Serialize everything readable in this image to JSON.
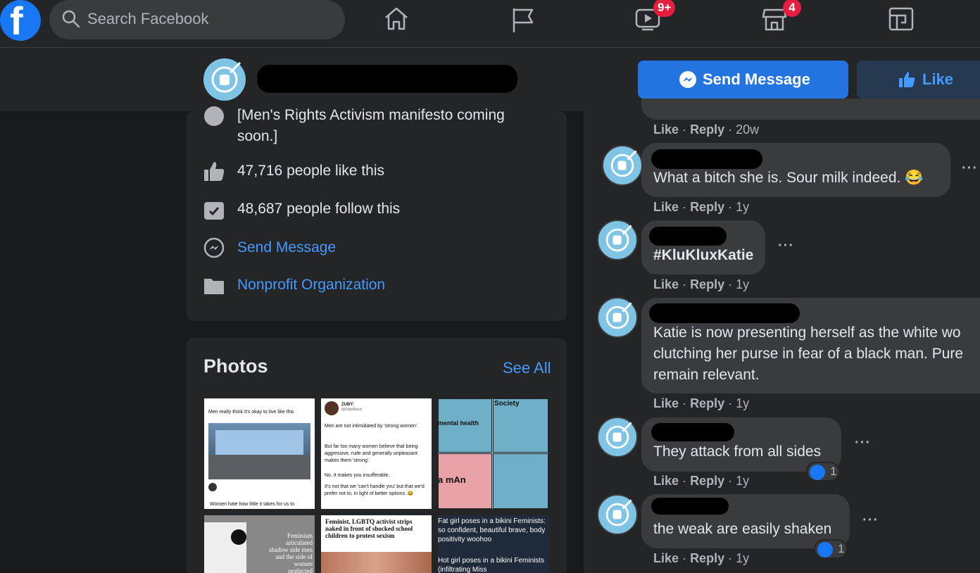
{
  "nav": {
    "logo": "f",
    "search_placeholder": "Search Facebook",
    "watch_badge": "9+",
    "marketplace_badge": "4"
  },
  "header": {
    "send_message": "Send Message",
    "like": "Like"
  },
  "about": {
    "description": "[Men's Rights Activism manifesto coming soon.]",
    "likes": "47,716 people like this",
    "follows": "48,687 people follow this",
    "send_message": "Send Message",
    "category": "Nonprofit Organization"
  },
  "photos": {
    "title": "Photos",
    "see_all": "See All",
    "tile1_caption": "Men really think it's okay to live like this",
    "tile1_footer": "Women hate how little it takes for us to",
    "tile2_name": "ZUBY:",
    "tile2_handle": "@ZubyMusic",
    "tile2_lines": [
      "Men are not intimidated by 'strong women'.",
      "But far too many women believe that being aggressive, rude and generally unpleasant makes them 'strong'.",
      "No. It makes you insufferable.",
      "It's not that we 'can't handle you' but that we'd prefer not to, in light of better options. 😂"
    ],
    "tile3_society": "Society",
    "tile3_mental": "mental health",
    "tile3_aman": "a mAn",
    "tile4_text": "Feminism articulated shadow side men and the side of women neglected",
    "tile5_text": "Feminist, LGBTQ activist strips naked in front of shocked school children to protest sexism",
    "tile6_text1": "Fat girl poses in a bikini Feminists: so confident, beautiful brave, body positivity woohoo",
    "tile6_text2": "Hot girl poses in a bikini Feminists (infiltrating Miss"
  },
  "comments": [
    {
      "text": "",
      "action_like": "Like",
      "action_reply": "Reply",
      "time": "20w"
    },
    {
      "text": "What a bitch she is. Sour milk indeed. 😂",
      "action_like": "Like",
      "action_reply": "Reply",
      "time": "1y"
    },
    {
      "text": "#KluKluxKatie",
      "action_like": "Like",
      "action_reply": "Reply",
      "time": "1y"
    },
    {
      "line1": "Katie is now presenting herself as the white wo",
      "line2": "clutching her purse in fear of a black man. Pure",
      "line3": "remain relevant.",
      "action_like": "Like",
      "action_reply": "Reply",
      "time": "1y"
    },
    {
      "text": "They attack from all sides",
      "reactions": "1",
      "action_like": "Like",
      "action_reply": "Reply",
      "time": "1y"
    },
    {
      "text": "the weak are easily shaken",
      "reactions": "1",
      "action_like": "Like",
      "action_reply": "Reply",
      "time": "1y"
    }
  ],
  "more_dots": "···",
  "sep": "·",
  "icons": [
    "facebook-logo-icon",
    "search-icon",
    "home-icon",
    "flag-icon",
    "watch-icon",
    "marketplace-icon",
    "gaming-icon",
    "messenger-icon",
    "thumbs-up-icon",
    "follow-icon",
    "category-icon",
    "info-icon",
    "fist-icon"
  ]
}
